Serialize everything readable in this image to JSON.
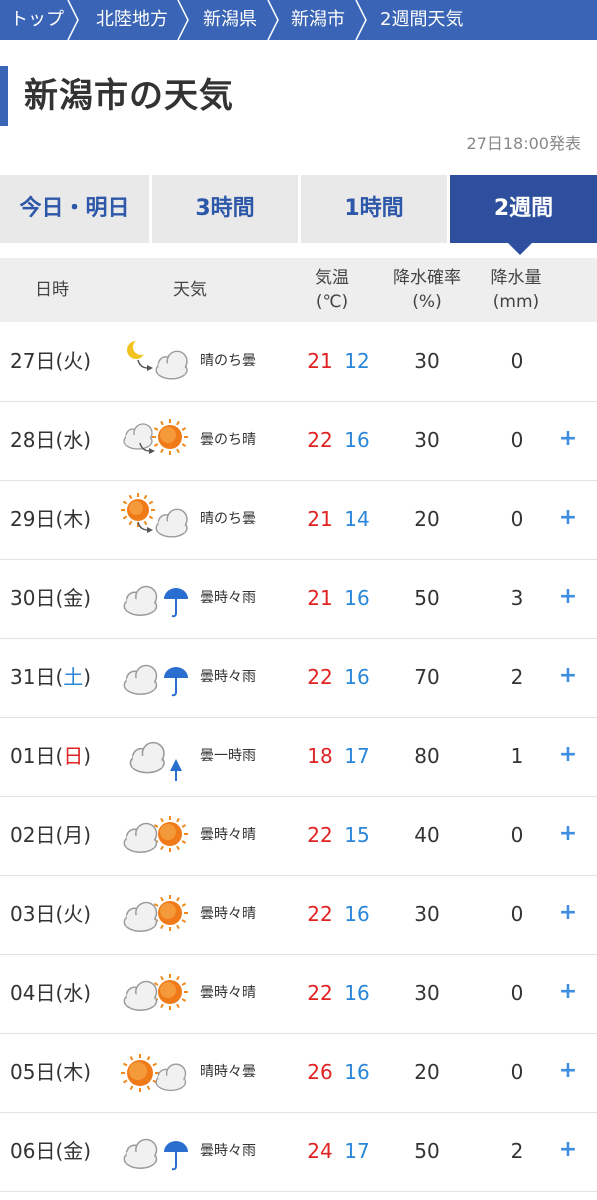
{
  "breadcrumb": [
    "トップ",
    "北陸地方",
    "新潟県",
    "新潟市",
    "2週間天気"
  ],
  "page_title": "新潟市の天気",
  "published": "27日18:00発表",
  "tabs": [
    "今日・明日",
    "3時間",
    "1時間",
    "2週間"
  ],
  "active_tab": "2週間",
  "table_headers": {
    "datetime": "日時",
    "weather": "天気",
    "temp_line1": "気温",
    "temp_line2": "(℃)",
    "pop_line1": "降水確率",
    "pop_line2": "(%)",
    "amount_line1": "降水量",
    "amount_line2": "(mm)"
  },
  "days": [
    {
      "day": "27日(",
      "wd": "火",
      "close": ")",
      "wd_color": "normal",
      "icon": "clear-night-then-cloudy",
      "weather": "晴のち曇",
      "high": "21",
      "low": "12",
      "pop": "30",
      "amount": "0",
      "plus": ""
    },
    {
      "day": "28日(",
      "wd": "水",
      "close": ")",
      "wd_color": "normal",
      "icon": "cloudy-then-sunny",
      "weather": "曇のち晴",
      "high": "22",
      "low": "16",
      "pop": "30",
      "amount": "0",
      "plus": "+"
    },
    {
      "day": "29日(",
      "wd": "木",
      "close": ")",
      "wd_color": "normal",
      "icon": "sunny-then-cloudy",
      "weather": "晴のち曇",
      "high": "21",
      "low": "14",
      "pop": "20",
      "amount": "0",
      "plus": "+"
    },
    {
      "day": "30日(",
      "wd": "金",
      "close": ")",
      "wd_color": "normal",
      "icon": "cloudy-occasional-rain",
      "weather": "曇時々雨",
      "high": "21",
      "low": "16",
      "pop": "50",
      "amount": "3",
      "plus": "+"
    },
    {
      "day": "31日(",
      "wd": "土",
      "close": ")",
      "wd_color": "saturday",
      "icon": "cloudy-occasional-rain",
      "weather": "曇時々雨",
      "high": "22",
      "low": "16",
      "pop": "70",
      "amount": "2",
      "plus": "+"
    },
    {
      "day": "01日(",
      "wd": "日",
      "close": ")",
      "wd_color": "sunday",
      "icon": "cloudy-brief-rain",
      "weather": "曇一時雨",
      "high": "18",
      "low": "17",
      "pop": "80",
      "amount": "1",
      "plus": "+"
    },
    {
      "day": "02日(",
      "wd": "月",
      "close": ")",
      "wd_color": "normal",
      "icon": "cloudy-occasional-sun",
      "weather": "曇時々晴",
      "high": "22",
      "low": "15",
      "pop": "40",
      "amount": "0",
      "plus": "+"
    },
    {
      "day": "03日(",
      "wd": "火",
      "close": ")",
      "wd_color": "normal",
      "icon": "cloudy-occasional-sun",
      "weather": "曇時々晴",
      "high": "22",
      "low": "16",
      "pop": "30",
      "amount": "0",
      "plus": "+"
    },
    {
      "day": "04日(",
      "wd": "水",
      "close": ")",
      "wd_color": "normal",
      "icon": "cloudy-occasional-sun",
      "weather": "曇時々晴",
      "high": "22",
      "low": "16",
      "pop": "30",
      "amount": "0",
      "plus": "+"
    },
    {
      "day": "05日(",
      "wd": "木",
      "close": ")",
      "wd_color": "normal",
      "icon": "sunny-occasional-cloud",
      "weather": "晴時々曇",
      "high": "26",
      "low": "16",
      "pop": "20",
      "amount": "0",
      "plus": "+"
    },
    {
      "day": "06日(",
      "wd": "金",
      "close": ")",
      "wd_color": "normal",
      "icon": "cloudy-occasional-rain",
      "weather": "曇時々雨",
      "high": "24",
      "low": "17",
      "pop": "50",
      "amount": "2",
      "plus": "+"
    }
  ],
  "colors": {
    "brand_blue": "#3a64b5",
    "active_tab": "#2d4f9d",
    "high_temp": "#e02222",
    "low_temp": "#2a86d8",
    "plus": "#3f8ee0"
  }
}
